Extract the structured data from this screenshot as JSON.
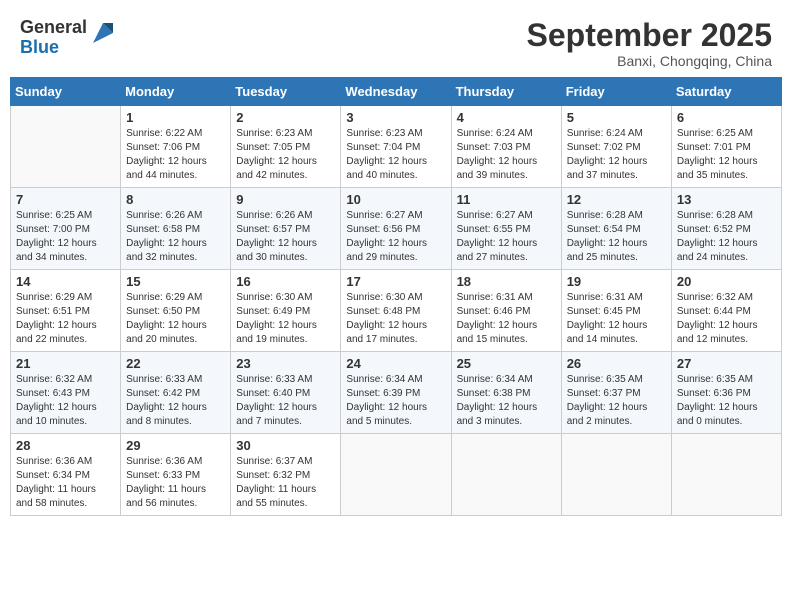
{
  "header": {
    "logo_general": "General",
    "logo_blue": "Blue",
    "month": "September 2025",
    "location": "Banxi, Chongqing, China"
  },
  "weekdays": [
    "Sunday",
    "Monday",
    "Tuesday",
    "Wednesday",
    "Thursday",
    "Friday",
    "Saturday"
  ],
  "weeks": [
    [
      {
        "day": "",
        "info": ""
      },
      {
        "day": "1",
        "info": "Sunrise: 6:22 AM\nSunset: 7:06 PM\nDaylight: 12 hours\nand 44 minutes."
      },
      {
        "day": "2",
        "info": "Sunrise: 6:23 AM\nSunset: 7:05 PM\nDaylight: 12 hours\nand 42 minutes."
      },
      {
        "day": "3",
        "info": "Sunrise: 6:23 AM\nSunset: 7:04 PM\nDaylight: 12 hours\nand 40 minutes."
      },
      {
        "day": "4",
        "info": "Sunrise: 6:24 AM\nSunset: 7:03 PM\nDaylight: 12 hours\nand 39 minutes."
      },
      {
        "day": "5",
        "info": "Sunrise: 6:24 AM\nSunset: 7:02 PM\nDaylight: 12 hours\nand 37 minutes."
      },
      {
        "day": "6",
        "info": "Sunrise: 6:25 AM\nSunset: 7:01 PM\nDaylight: 12 hours\nand 35 minutes."
      }
    ],
    [
      {
        "day": "7",
        "info": "Sunrise: 6:25 AM\nSunset: 7:00 PM\nDaylight: 12 hours\nand 34 minutes."
      },
      {
        "day": "8",
        "info": "Sunrise: 6:26 AM\nSunset: 6:58 PM\nDaylight: 12 hours\nand 32 minutes."
      },
      {
        "day": "9",
        "info": "Sunrise: 6:26 AM\nSunset: 6:57 PM\nDaylight: 12 hours\nand 30 minutes."
      },
      {
        "day": "10",
        "info": "Sunrise: 6:27 AM\nSunset: 6:56 PM\nDaylight: 12 hours\nand 29 minutes."
      },
      {
        "day": "11",
        "info": "Sunrise: 6:27 AM\nSunset: 6:55 PM\nDaylight: 12 hours\nand 27 minutes."
      },
      {
        "day": "12",
        "info": "Sunrise: 6:28 AM\nSunset: 6:54 PM\nDaylight: 12 hours\nand 25 minutes."
      },
      {
        "day": "13",
        "info": "Sunrise: 6:28 AM\nSunset: 6:52 PM\nDaylight: 12 hours\nand 24 minutes."
      }
    ],
    [
      {
        "day": "14",
        "info": "Sunrise: 6:29 AM\nSunset: 6:51 PM\nDaylight: 12 hours\nand 22 minutes."
      },
      {
        "day": "15",
        "info": "Sunrise: 6:29 AM\nSunset: 6:50 PM\nDaylight: 12 hours\nand 20 minutes."
      },
      {
        "day": "16",
        "info": "Sunrise: 6:30 AM\nSunset: 6:49 PM\nDaylight: 12 hours\nand 19 minutes."
      },
      {
        "day": "17",
        "info": "Sunrise: 6:30 AM\nSunset: 6:48 PM\nDaylight: 12 hours\nand 17 minutes."
      },
      {
        "day": "18",
        "info": "Sunrise: 6:31 AM\nSunset: 6:46 PM\nDaylight: 12 hours\nand 15 minutes."
      },
      {
        "day": "19",
        "info": "Sunrise: 6:31 AM\nSunset: 6:45 PM\nDaylight: 12 hours\nand 14 minutes."
      },
      {
        "day": "20",
        "info": "Sunrise: 6:32 AM\nSunset: 6:44 PM\nDaylight: 12 hours\nand 12 minutes."
      }
    ],
    [
      {
        "day": "21",
        "info": "Sunrise: 6:32 AM\nSunset: 6:43 PM\nDaylight: 12 hours\nand 10 minutes."
      },
      {
        "day": "22",
        "info": "Sunrise: 6:33 AM\nSunset: 6:42 PM\nDaylight: 12 hours\nand 8 minutes."
      },
      {
        "day": "23",
        "info": "Sunrise: 6:33 AM\nSunset: 6:40 PM\nDaylight: 12 hours\nand 7 minutes."
      },
      {
        "day": "24",
        "info": "Sunrise: 6:34 AM\nSunset: 6:39 PM\nDaylight: 12 hours\nand 5 minutes."
      },
      {
        "day": "25",
        "info": "Sunrise: 6:34 AM\nSunset: 6:38 PM\nDaylight: 12 hours\nand 3 minutes."
      },
      {
        "day": "26",
        "info": "Sunrise: 6:35 AM\nSunset: 6:37 PM\nDaylight: 12 hours\nand 2 minutes."
      },
      {
        "day": "27",
        "info": "Sunrise: 6:35 AM\nSunset: 6:36 PM\nDaylight: 12 hours\nand 0 minutes."
      }
    ],
    [
      {
        "day": "28",
        "info": "Sunrise: 6:36 AM\nSunset: 6:34 PM\nDaylight: 11 hours\nand 58 minutes."
      },
      {
        "day": "29",
        "info": "Sunrise: 6:36 AM\nSunset: 6:33 PM\nDaylight: 11 hours\nand 56 minutes."
      },
      {
        "day": "30",
        "info": "Sunrise: 6:37 AM\nSunset: 6:32 PM\nDaylight: 11 hours\nand 55 minutes."
      },
      {
        "day": "",
        "info": ""
      },
      {
        "day": "",
        "info": ""
      },
      {
        "day": "",
        "info": ""
      },
      {
        "day": "",
        "info": ""
      }
    ]
  ]
}
